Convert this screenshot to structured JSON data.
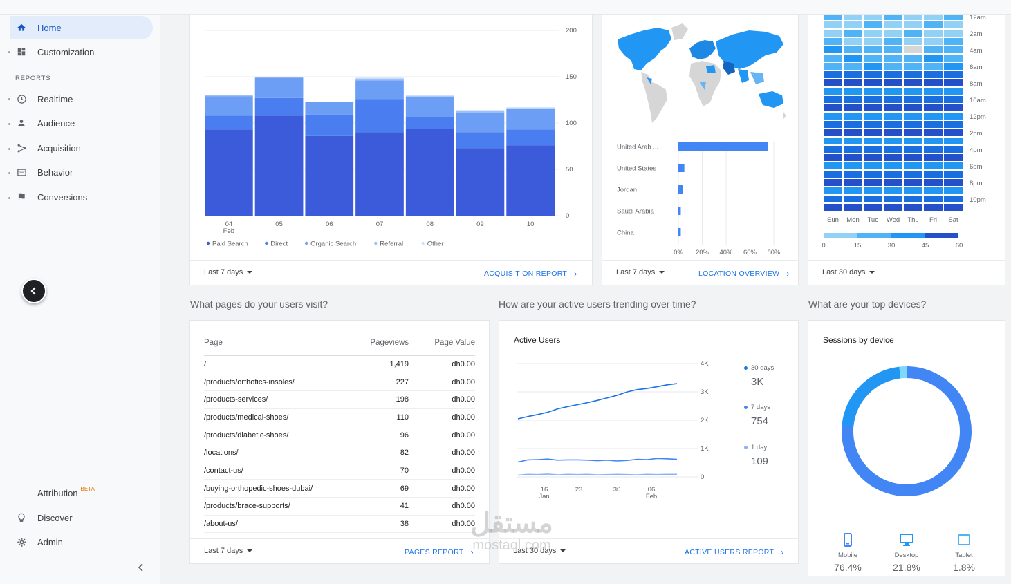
{
  "sidebar": {
    "items": [
      {
        "label": "Home",
        "icon": "home-icon"
      },
      {
        "label": "Customization",
        "icon": "dashboard-icon"
      },
      {
        "label": "Realtime",
        "icon": "clock-icon"
      },
      {
        "label": "Audience",
        "icon": "person-icon"
      },
      {
        "label": "Acquisition",
        "icon": "acquisition-icon"
      },
      {
        "label": "Behavior",
        "icon": "behavior-icon"
      },
      {
        "label": "Conversions",
        "icon": "flag-icon"
      }
    ],
    "reports_header": "REPORTS",
    "attribution_label": "Attribution",
    "attribution_badge": "BETA",
    "discover_label": "Discover",
    "admin_label": "Admin"
  },
  "acquisition_card": {
    "range": "Last 7 days",
    "report_link": "ACQUISITION REPORT",
    "chart_data": {
      "type": "bar",
      "stacked": true,
      "categories": [
        "04",
        "05",
        "06",
        "07",
        "08",
        "09",
        "10"
      ],
      "first_category_sublabel": "Feb",
      "ylim": [
        0,
        200
      ],
      "yticks": [
        0,
        50,
        100,
        150,
        200
      ],
      "legend_position": "bottom",
      "series": [
        {
          "name": "Paid Search",
          "color": "#3b5bdb",
          "values": [
            93,
            108,
            86,
            90,
            94,
            73,
            76
          ]
        },
        {
          "name": "Direct",
          "color": "#4a7ef0",
          "values": [
            15,
            19,
            23,
            36,
            12,
            17,
            17
          ]
        },
        {
          "name": "Organic Search",
          "color": "#6d9ef5",
          "values": [
            21,
            22,
            14,
            20,
            22,
            21,
            22
          ]
        },
        {
          "name": "Referral",
          "color": "#9dc0f7",
          "values": [
            1,
            1,
            0,
            2,
            1,
            2,
            1
          ]
        },
        {
          "name": "Other",
          "color": "#cde0fb",
          "values": [
            0,
            0,
            0,
            1,
            1,
            1,
            1
          ]
        }
      ]
    }
  },
  "location_card": {
    "range": "Last 7 days",
    "report_link": "LOCATION OVERVIEW",
    "chart_data": {
      "type": "bar",
      "orientation": "horizontal",
      "categories": [
        "United Arab ...",
        "United States",
        "Jordan",
        "Saudi Arabia",
        "China"
      ],
      "values": [
        75,
        5,
        4,
        2,
        2
      ],
      "xlim": [
        0,
        80
      ],
      "xticks": [
        "0%",
        "20%",
        "40%",
        "60%",
        "80%"
      ]
    }
  },
  "heatmap_card": {
    "range": "Last 30 days",
    "chart_data": {
      "type": "heatmap",
      "days": [
        "Sun",
        "Mon",
        "Tue",
        "Wed",
        "Thu",
        "Fri",
        "Sat"
      ],
      "hours": [
        "12am",
        "2am",
        "4am",
        "6am",
        "8am",
        "10am",
        "12pm",
        "2pm",
        "4pm",
        "6pm",
        "8pm",
        "10pm"
      ],
      "scale_ticks": [
        "0",
        "15",
        "30",
        "45",
        "60"
      ]
    }
  },
  "pages_section": {
    "question": "What pages do your users visit?",
    "headers": {
      "page": "Page",
      "pageviews": "Pageviews",
      "value": "Page Value"
    },
    "rows": [
      {
        "page": "/",
        "views": "1,419",
        "value": "dh0.00"
      },
      {
        "page": "/products/orthotics-insoles/",
        "views": "227",
        "value": "dh0.00"
      },
      {
        "page": "/products-services/",
        "views": "198",
        "value": "dh0.00"
      },
      {
        "page": "/products/medical-shoes/",
        "views": "110",
        "value": "dh0.00"
      },
      {
        "page": "/products/diabetic-shoes/",
        "views": "96",
        "value": "dh0.00"
      },
      {
        "page": "/locations/",
        "views": "82",
        "value": "dh0.00"
      },
      {
        "page": "/contact-us/",
        "views": "70",
        "value": "dh0.00"
      },
      {
        "page": "/buying-orthopedic-shoes-dubai/",
        "views": "69",
        "value": "dh0.00"
      },
      {
        "page": "/products/brace-supports/",
        "views": "41",
        "value": "dh0.00"
      },
      {
        "page": "/about-us/",
        "views": "38",
        "value": "dh0.00"
      }
    ],
    "range": "Last 7 days",
    "report_link": "PAGES REPORT"
  },
  "active_users_section": {
    "question": "How are your active users trending over time?",
    "title": "Active Users",
    "range": "Last 30 days",
    "report_link": "ACTIVE USERS REPORT",
    "metrics": [
      {
        "label": "30 days",
        "value": "3K",
        "color": "#1a73e8"
      },
      {
        "label": "7 days",
        "value": "754",
        "color": "#4285f4"
      },
      {
        "label": "1 day",
        "value": "109",
        "color": "#8ab4f8"
      }
    ],
    "chart_data": {
      "type": "line",
      "x_ticks": [
        "16",
        "23",
        "30",
        "06"
      ],
      "x_sublabels": [
        "Jan",
        "",
        "",
        "Feb"
      ],
      "yticks": [
        "0",
        "1K",
        "2K",
        "3K",
        "4K"
      ],
      "ylim": [
        0,
        4000
      ],
      "series": [
        {
          "name": "30 days",
          "color": "#1a73e8",
          "values": [
            2050,
            2130,
            2200,
            2280,
            2400,
            2480,
            2550,
            2620,
            2700,
            2790,
            2880,
            3000,
            3080,
            3120,
            3180,
            3250,
            3290
          ]
        },
        {
          "name": "7 days",
          "color": "#4285f4",
          "values": [
            520,
            600,
            610,
            630,
            590,
            600,
            600,
            590,
            570,
            590,
            560,
            580,
            620,
            610,
            650,
            640,
            620
          ]
        },
        {
          "name": "1 day",
          "color": "#8ab4f8",
          "values": [
            60,
            90,
            80,
            100,
            70,
            90,
            80,
            90,
            70,
            80,
            90,
            80,
            70,
            90,
            80,
            90,
            90
          ]
        }
      ]
    }
  },
  "devices_section": {
    "question": "What are your top devices?",
    "title": "Sessions by device",
    "chart_data": {
      "type": "pie",
      "donut": true,
      "labels": [
        "Mobile",
        "Desktop",
        "Tablet"
      ],
      "values": [
        76.4,
        21.8,
        1.8
      ],
      "colors": [
        "#4285f4",
        "#2196f3",
        "#80d8f8"
      ]
    },
    "devices": [
      {
        "label": "Mobile",
        "value": "76.4%",
        "icon": "mobile-icon"
      },
      {
        "label": "Desktop",
        "value": "21.8%",
        "icon": "desktop-icon"
      },
      {
        "label": "Tablet",
        "value": "1.8%",
        "icon": "tablet-icon"
      }
    ]
  },
  "watermark": {
    "arabic": "مستقل",
    "latin": "mostaql.com"
  }
}
